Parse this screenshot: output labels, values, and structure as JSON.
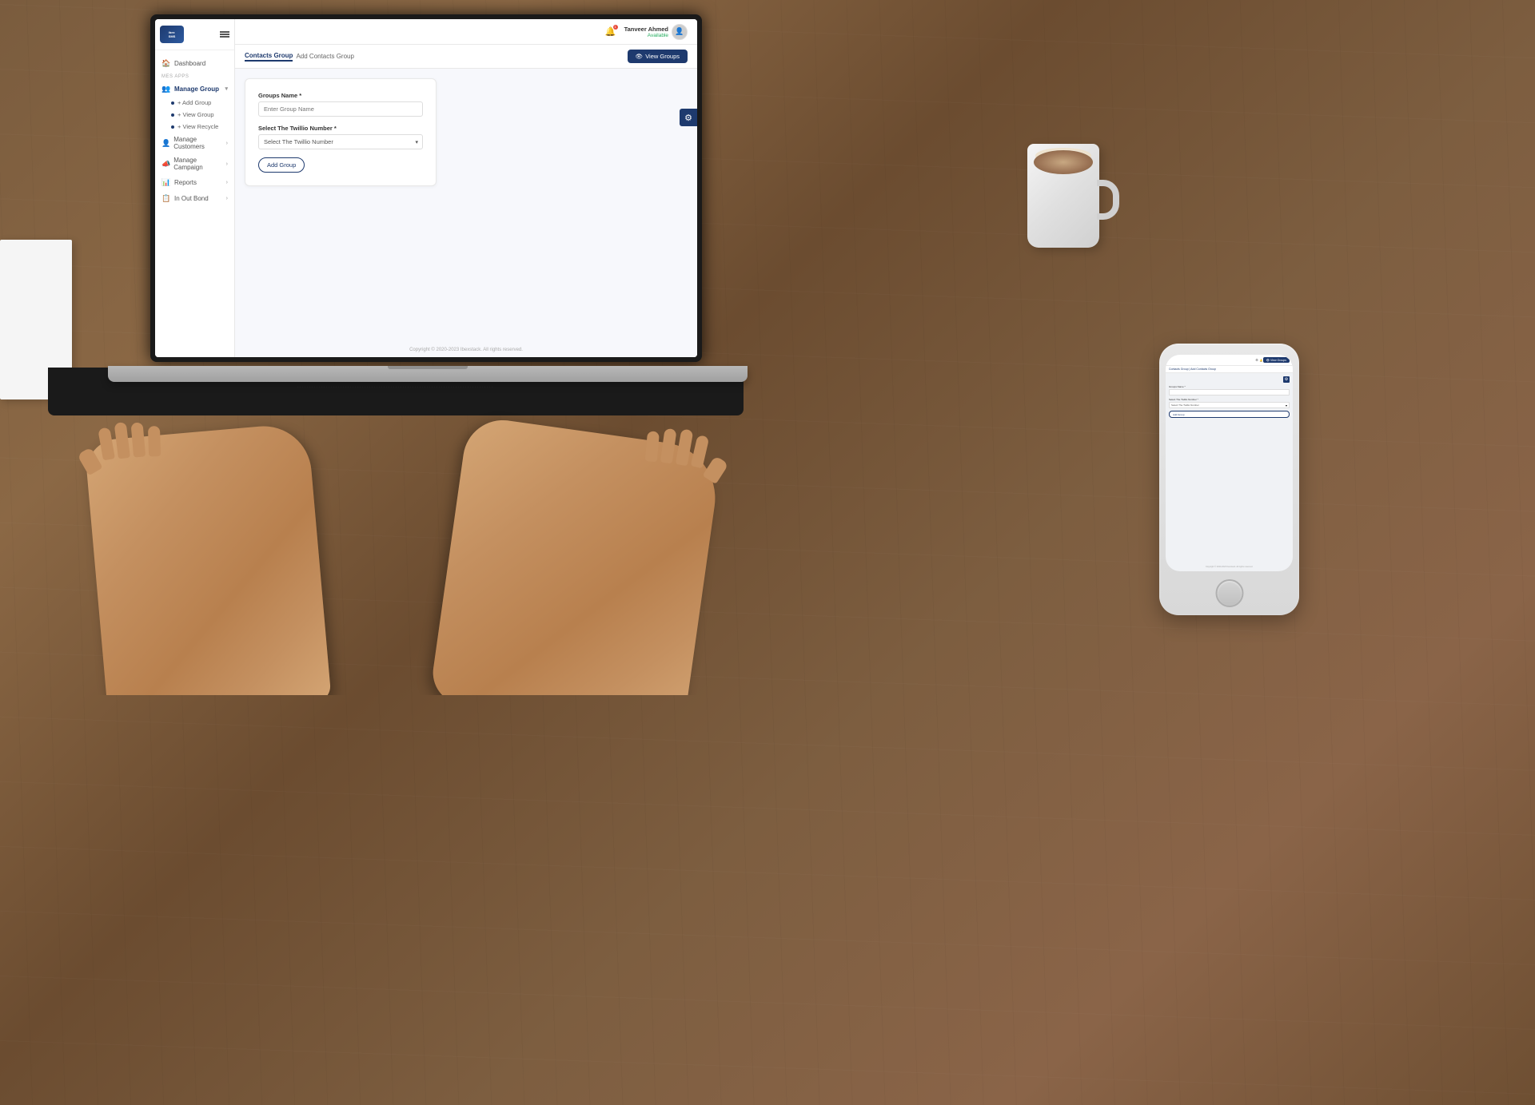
{
  "app": {
    "logo_text": "ibex SMS",
    "title": "Contacts Group"
  },
  "header": {
    "tabs": [
      {
        "label": "Contacts Group",
        "active": true
      },
      {
        "label": "Add Contacts Group",
        "active": false
      }
    ],
    "view_groups_btn": "View Groups",
    "view_groups_icon": "👁"
  },
  "user": {
    "name": "Tanveer Ahmed",
    "status": "Available",
    "avatar_icon": "👤"
  },
  "notification": {
    "icon": "🔔",
    "count": "1"
  },
  "sidebar": {
    "section_label": "MES APPS",
    "dashboard_label": "Dashboard",
    "dashboard_icon": "🏠",
    "menu_items": [
      {
        "label": "Manage Group",
        "icon": "👥",
        "expanded": true,
        "submenu": [
          {
            "label": "Add Group",
            "active": false
          },
          {
            "label": "View Group",
            "active": false
          },
          {
            "label": "View Recycle",
            "active": false
          }
        ]
      },
      {
        "label": "Manage Customers",
        "icon": "👤",
        "expanded": false,
        "submenu": []
      },
      {
        "label": "Manage Campaign",
        "icon": "📣",
        "expanded": false,
        "submenu": []
      },
      {
        "label": "Reports",
        "icon": "📊",
        "expanded": false,
        "submenu": []
      },
      {
        "label": "In Out Bond",
        "icon": "📋",
        "expanded": false,
        "submenu": []
      }
    ]
  },
  "form": {
    "groups_name_label": "Groups Name *",
    "groups_name_placeholder": "Enter Group Name",
    "twilio_label": "Select The Twillio Number *",
    "twilio_placeholder": "Select The Twillio Number",
    "twilio_options": [
      "Select The Twillio Number"
    ],
    "add_group_btn": "Add Group"
  },
  "footer": {
    "copyright": "Copyright © 2020-2023 Ibexstack. All rights reserved."
  }
}
